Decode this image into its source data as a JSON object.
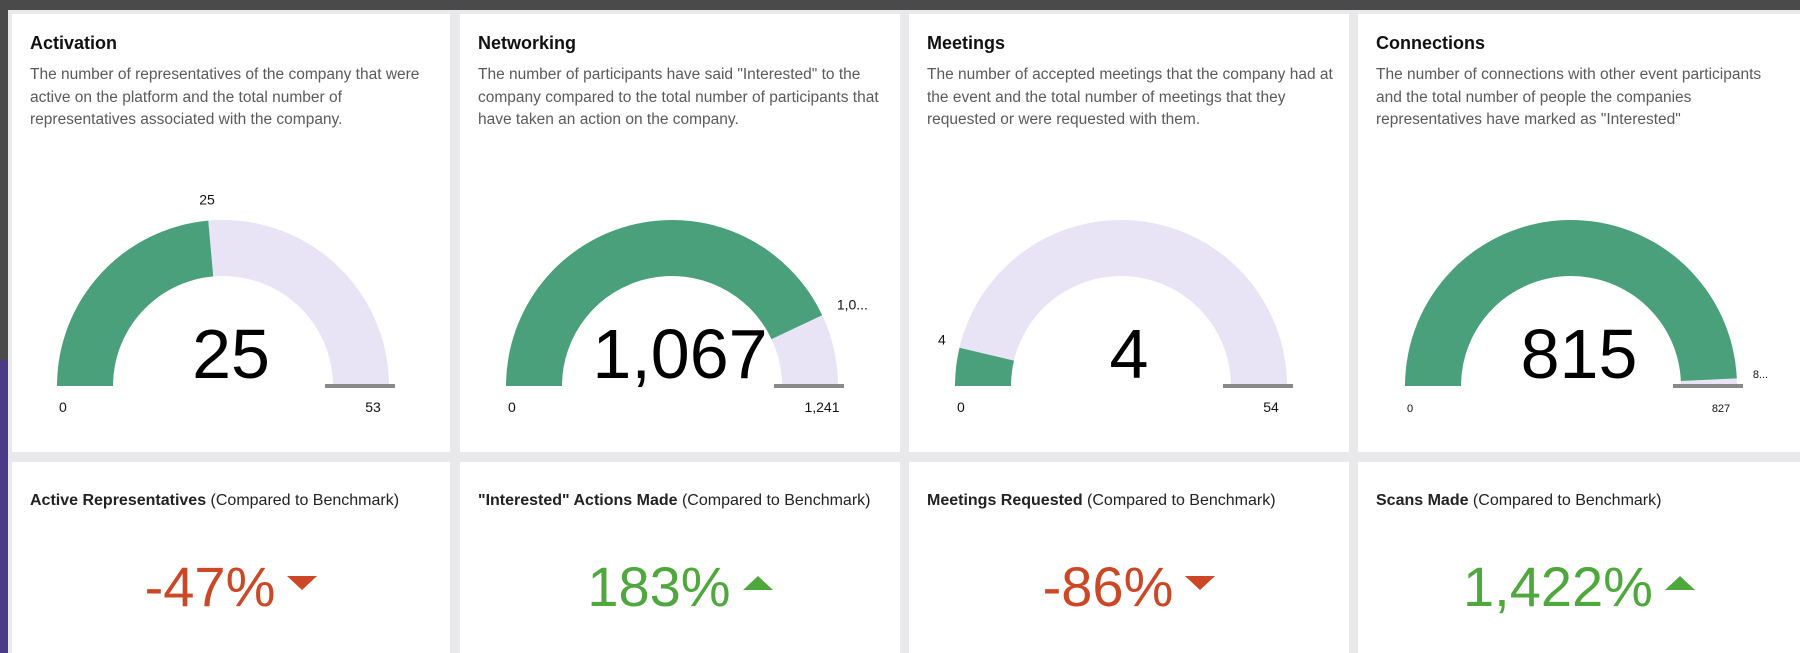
{
  "colors": {
    "filled": "#4aa07a",
    "remaining": "#e8e4f6",
    "marker": "#8a8a8a",
    "negative": "#cc4725",
    "positive": "#4fa83d"
  },
  "gauges": [
    {
      "title": "Activation",
      "description": "The number of representatives of the company that were active on the platform and the total number of representatives associated with the company.",
      "value": 25,
      "max": 53,
      "value_display": "25",
      "min_label": "0",
      "max_label": "53",
      "value_label": "25"
    },
    {
      "title": "Networking",
      "description": "The number of participants have said \"Interested\" to the company compared to the total number of participants that have taken an action on the company.",
      "value": 1067,
      "max": 1241,
      "value_display": "1,067",
      "min_label": "0",
      "max_label": "1,241",
      "value_label": "1,0..."
    },
    {
      "title": "Meetings",
      "description": "The number of accepted meetings that the company had at the event and the total number of meetings that they requested or were requested with them.",
      "value": 4,
      "max": 54,
      "value_display": "4",
      "min_label": "0",
      "max_label": "54",
      "value_label": "4"
    },
    {
      "title": "Connections",
      "description": "The number of connections with other event participants and the total number of people the companies representatives have marked as \"Interested\"",
      "value": 815,
      "max": 827,
      "value_display": "815",
      "min_label": "0",
      "max_label": "827",
      "value_label": "8..."
    }
  ],
  "kpis": [
    {
      "title_bold": "Active Representatives",
      "title_rest": " (Compared to Benchmark)",
      "value": "-47%",
      "direction": "down"
    },
    {
      "title_bold": "\"Interested\" Actions Made",
      "title_rest": " (Compared to Benchmark)",
      "value": "183%",
      "direction": "up"
    },
    {
      "title_bold": "Meetings Requested",
      "title_rest": " (Compared to Benchmark)",
      "value": "-86%",
      "direction": "down"
    },
    {
      "title_bold": "Scans Made",
      "title_rest": " (Compared to Benchmark)",
      "value": "1,422%",
      "direction": "up"
    }
  ]
}
